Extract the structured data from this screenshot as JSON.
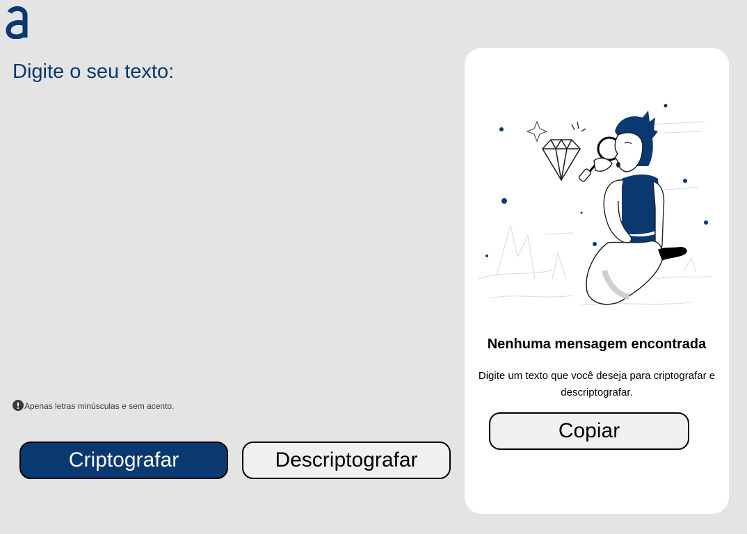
{
  "logo": {
    "icon": "alura-a-logo-icon",
    "color": "#0a3871"
  },
  "input": {
    "placeholder": "Digite o seu texto:",
    "value": ""
  },
  "hint": {
    "icon": "exclamation-circle-icon",
    "text": "Apenas letras minúsculas e sem acento."
  },
  "actions": {
    "encrypt_label": "Criptografar",
    "decrypt_label": "Descriptografar"
  },
  "output": {
    "illustration": "person-with-magnifying-glass-illustration",
    "title": "Nenhuma mensagem encontrada",
    "message": "Digite um texto que você deseja para criptografar e descriptografar.",
    "copy_label": "Copiar"
  },
  "colors": {
    "background": "#e4e4e4",
    "primary": "#0a3871",
    "card": "#ffffff",
    "button_light": "#f0f0f0"
  }
}
